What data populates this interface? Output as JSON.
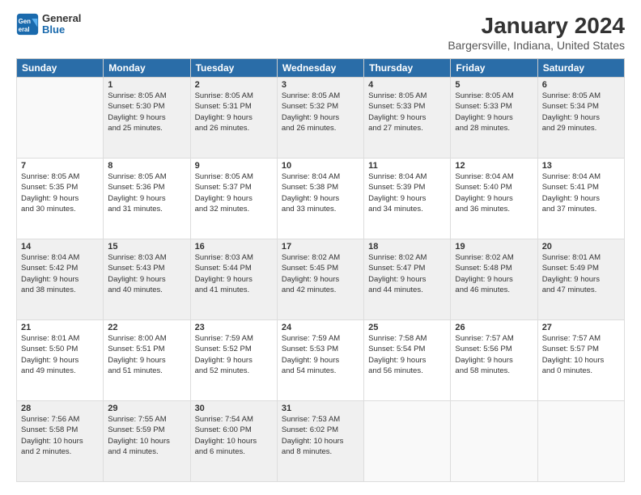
{
  "header": {
    "logo_general": "General",
    "logo_blue": "Blue",
    "title": "January 2024",
    "subtitle": "Bargersville, Indiana, United States"
  },
  "columns": [
    "Sunday",
    "Monday",
    "Tuesday",
    "Wednesday",
    "Thursday",
    "Friday",
    "Saturday"
  ],
  "weeks": [
    [
      {
        "num": "",
        "info": ""
      },
      {
        "num": "1",
        "info": "Sunrise: 8:05 AM\nSunset: 5:30 PM\nDaylight: 9 hours\nand 25 minutes."
      },
      {
        "num": "2",
        "info": "Sunrise: 8:05 AM\nSunset: 5:31 PM\nDaylight: 9 hours\nand 26 minutes."
      },
      {
        "num": "3",
        "info": "Sunrise: 8:05 AM\nSunset: 5:32 PM\nDaylight: 9 hours\nand 26 minutes."
      },
      {
        "num": "4",
        "info": "Sunrise: 8:05 AM\nSunset: 5:33 PM\nDaylight: 9 hours\nand 27 minutes."
      },
      {
        "num": "5",
        "info": "Sunrise: 8:05 AM\nSunset: 5:33 PM\nDaylight: 9 hours\nand 28 minutes."
      },
      {
        "num": "6",
        "info": "Sunrise: 8:05 AM\nSunset: 5:34 PM\nDaylight: 9 hours\nand 29 minutes."
      }
    ],
    [
      {
        "num": "7",
        "info": "Sunrise: 8:05 AM\nSunset: 5:35 PM\nDaylight: 9 hours\nand 30 minutes."
      },
      {
        "num": "8",
        "info": "Sunrise: 8:05 AM\nSunset: 5:36 PM\nDaylight: 9 hours\nand 31 minutes."
      },
      {
        "num": "9",
        "info": "Sunrise: 8:05 AM\nSunset: 5:37 PM\nDaylight: 9 hours\nand 32 minutes."
      },
      {
        "num": "10",
        "info": "Sunrise: 8:04 AM\nSunset: 5:38 PM\nDaylight: 9 hours\nand 33 minutes."
      },
      {
        "num": "11",
        "info": "Sunrise: 8:04 AM\nSunset: 5:39 PM\nDaylight: 9 hours\nand 34 minutes."
      },
      {
        "num": "12",
        "info": "Sunrise: 8:04 AM\nSunset: 5:40 PM\nDaylight: 9 hours\nand 36 minutes."
      },
      {
        "num": "13",
        "info": "Sunrise: 8:04 AM\nSunset: 5:41 PM\nDaylight: 9 hours\nand 37 minutes."
      }
    ],
    [
      {
        "num": "14",
        "info": "Sunrise: 8:04 AM\nSunset: 5:42 PM\nDaylight: 9 hours\nand 38 minutes."
      },
      {
        "num": "15",
        "info": "Sunrise: 8:03 AM\nSunset: 5:43 PM\nDaylight: 9 hours\nand 40 minutes."
      },
      {
        "num": "16",
        "info": "Sunrise: 8:03 AM\nSunset: 5:44 PM\nDaylight: 9 hours\nand 41 minutes."
      },
      {
        "num": "17",
        "info": "Sunrise: 8:02 AM\nSunset: 5:45 PM\nDaylight: 9 hours\nand 42 minutes."
      },
      {
        "num": "18",
        "info": "Sunrise: 8:02 AM\nSunset: 5:47 PM\nDaylight: 9 hours\nand 44 minutes."
      },
      {
        "num": "19",
        "info": "Sunrise: 8:02 AM\nSunset: 5:48 PM\nDaylight: 9 hours\nand 46 minutes."
      },
      {
        "num": "20",
        "info": "Sunrise: 8:01 AM\nSunset: 5:49 PM\nDaylight: 9 hours\nand 47 minutes."
      }
    ],
    [
      {
        "num": "21",
        "info": "Sunrise: 8:01 AM\nSunset: 5:50 PM\nDaylight: 9 hours\nand 49 minutes."
      },
      {
        "num": "22",
        "info": "Sunrise: 8:00 AM\nSunset: 5:51 PM\nDaylight: 9 hours\nand 51 minutes."
      },
      {
        "num": "23",
        "info": "Sunrise: 7:59 AM\nSunset: 5:52 PM\nDaylight: 9 hours\nand 52 minutes."
      },
      {
        "num": "24",
        "info": "Sunrise: 7:59 AM\nSunset: 5:53 PM\nDaylight: 9 hours\nand 54 minutes."
      },
      {
        "num": "25",
        "info": "Sunrise: 7:58 AM\nSunset: 5:54 PM\nDaylight: 9 hours\nand 56 minutes."
      },
      {
        "num": "26",
        "info": "Sunrise: 7:57 AM\nSunset: 5:56 PM\nDaylight: 9 hours\nand 58 minutes."
      },
      {
        "num": "27",
        "info": "Sunrise: 7:57 AM\nSunset: 5:57 PM\nDaylight: 10 hours\nand 0 minutes."
      }
    ],
    [
      {
        "num": "28",
        "info": "Sunrise: 7:56 AM\nSunset: 5:58 PM\nDaylight: 10 hours\nand 2 minutes."
      },
      {
        "num": "29",
        "info": "Sunrise: 7:55 AM\nSunset: 5:59 PM\nDaylight: 10 hours\nand 4 minutes."
      },
      {
        "num": "30",
        "info": "Sunrise: 7:54 AM\nSunset: 6:00 PM\nDaylight: 10 hours\nand 6 minutes."
      },
      {
        "num": "31",
        "info": "Sunrise: 7:53 AM\nSunset: 6:02 PM\nDaylight: 10 hours\nand 8 minutes."
      },
      {
        "num": "",
        "info": ""
      },
      {
        "num": "",
        "info": ""
      },
      {
        "num": "",
        "info": ""
      }
    ]
  ]
}
